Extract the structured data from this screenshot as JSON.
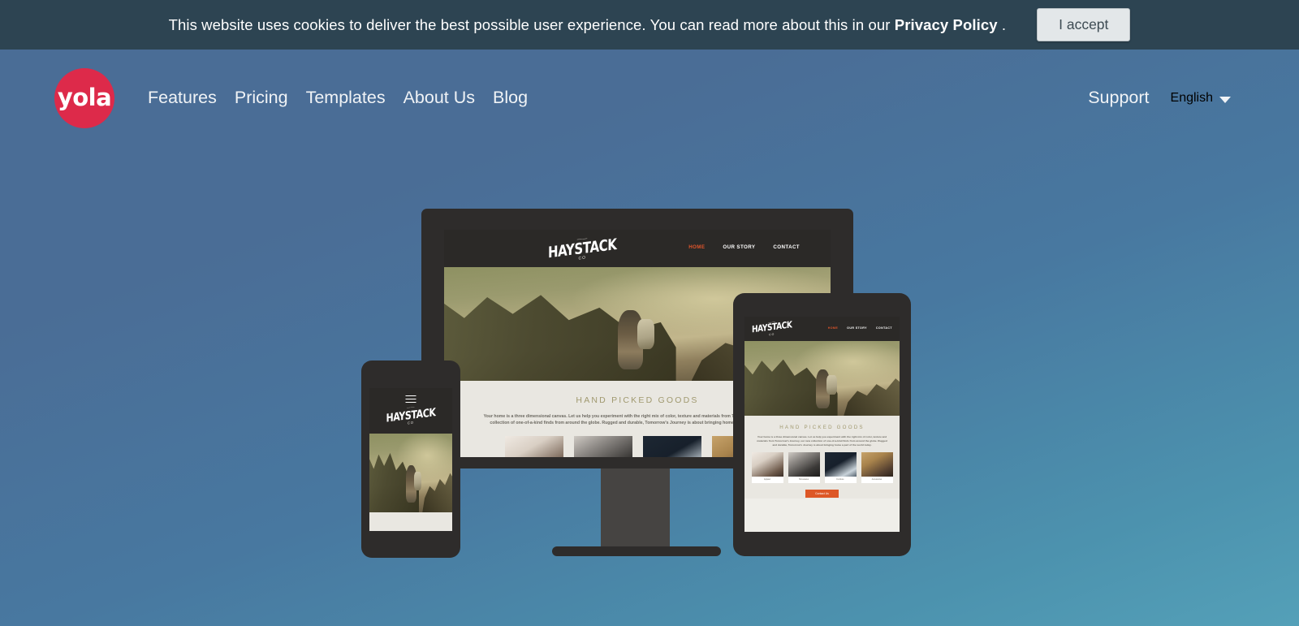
{
  "cookie_banner": {
    "text_before": "This website uses cookies to deliver the best possible user experience. You can read more about this in our ",
    "privacy_link": "Privacy Policy",
    "text_after": " .",
    "accept_label": "I accept"
  },
  "header": {
    "logo_text": "yola",
    "nav": [
      {
        "label": "Features"
      },
      {
        "label": "Pricing"
      },
      {
        "label": "Templates"
      },
      {
        "label": "About Us"
      },
      {
        "label": "Blog"
      }
    ],
    "support_label": "Support",
    "language_label": "English",
    "caret_icon": "chevron-down-icon"
  },
  "mockup_site": {
    "brand": {
      "swoosh": "――",
      "name": "HAYSTACK",
      "suffix": "CO"
    },
    "nav": [
      {
        "label": "HOME",
        "active": true
      },
      {
        "label": "OUR STORY",
        "active": false
      },
      {
        "label": "CONTACT",
        "active": false
      }
    ],
    "hero_alt": "hiker-on-mountain-ridge",
    "section_title": "HAND PICKED GOODS",
    "section_copy": "Your home is a three dimensional canvas. Let us help you experiment with the right mix of color, texture and materials from Tomorrow's Journey, our new collection of one-of-a-kind finds from around the globe. Rugged and durable, Tomorrow's Journey is about bringing home a part of the world today.",
    "cards": [
      {
        "label": "Apparel"
      },
      {
        "label": "Homewares"
      },
      {
        "label": "Furniture"
      },
      {
        "label": "Accessories"
      }
    ],
    "cta_label": "Contact Us",
    "menu_icon": "hamburger-menu-icon"
  },
  "devices": {
    "monitor": "desktop-monitor-mockup",
    "tablet": "tablet-mockup",
    "phone": "phone-mockup"
  },
  "colors": {
    "brand_red": "#dd2a4a",
    "banner_bg": "#2d4452",
    "page_gradient_top": "#4a6d96",
    "page_gradient_bottom": "#54a0b8",
    "accent_orange": "#e0552b",
    "cta_orange": "#dd5726",
    "device_body": "#2e2c2b",
    "site_topbar": "#2b2927",
    "site_body_bg": "#e9e7e1",
    "goods_title": "#a0996f"
  }
}
